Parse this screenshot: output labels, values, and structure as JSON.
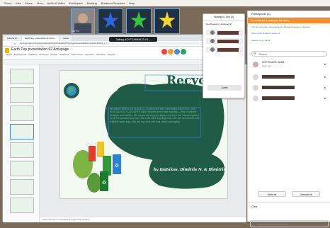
{
  "menubar": {
    "items": [
      "Zoom",
      "Edit",
      "Share",
      "View",
      "Audio & Video",
      "Participant",
      "Meeting",
      "Breakout Sessions",
      "Help"
    ]
  },
  "video": {
    "tiles": [
      {
        "label": "SOTTI...",
        "kind": "host"
      },
      {
        "label": "",
        "star_color": "#2f64e0"
      },
      {
        "label": "",
        "star_color": "#36c43a"
      },
      {
        "label": "",
        "star_color": "#f2d62b"
      }
    ],
    "talking": "Talking: ΚΟΥΤΣΑΜΑΝΟΣ ΚΩ..."
  },
  "browser": {
    "tabs": [
      "Adverts Gr.",
      "Earth Day presentation 62 Activ...",
      "Reset"
    ],
    "url": "docs.google.com/presentation/d/1oHbNxMqRuxtP6pyXgpXAe/edit#slide=id.g11fe12345_0_1",
    "doc_title": "Earth Day presentation 62 Activpage",
    "doc_menu": [
      "Αρχείο",
      "Επεξεργασία",
      "Προβολή",
      "Εισαγωγή",
      "Μορφή",
      "Διαφάνεια",
      "Τακτοποίηση",
      "Εργαλεία",
      "Πρόσθετα",
      "Βοήθεια"
    ],
    "notes": "Κάντε κλικ για να προσθέσετε σημειώσεις ομιλητή"
  },
  "slide": {
    "title": "Recycle",
    "body": "WE MUST RECYCLE PLASTIC—TOGETHER WE CAN MAKE RECYCLE—WE SHOULD RECYCLE PAPER (fake recycling bins made available—Buy recyclable products and bottles—We should use recycled paper—Look for the recycled symbol on all the products you buy—We must start recycling now—We can use a bottle with refillable water bag—We can buy food with less plastic packaging)",
    "credit": "by Ipatakos, Dimitris N. & Dimitris Ts.",
    "bins": [
      "#e33b2e",
      "#f2c12e",
      "#2f9a3c",
      "#2b7fd4"
    ],
    "colors": {
      "blob": "#1f5b46",
      "blob_text": "#6fb79a",
      "title": "#1f5b46",
      "background": "#f2f9f1"
    }
  },
  "waiting_popup": {
    "title": "Waiting to Join (3)",
    "not_signed": "Not Signed In / External (3)",
    "admit_label": "Admit"
  },
  "participants": {
    "header": "Participants (4)",
    "waiting_text": "1 participant is waiting in the lobby",
    "breakout_text": "You are currently connected to the Breakout session 1 session.",
    "show_other": "Show other breakout sessions",
    "session_time": "Session time: 29:41",
    "search_placeholder": "Search",
    "list": [
      {
        "name": "ΚΟΥΤΣΑΚΟΣ ΝΑΝΑ",
        "subtitle": "Host, me"
      },
      {
        "name": ""
      },
      {
        "name": ""
      },
      {
        "name": ""
      }
    ],
    "mute_all": "Mute all",
    "unmute_all": "Unmute all",
    "chat_header": "Chat",
    "chat_placeholder": "Everyone in the breakout session"
  }
}
